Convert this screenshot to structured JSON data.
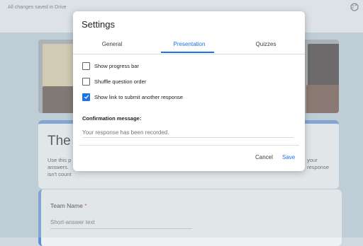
{
  "app": {
    "save_status": "All changes saved in Drive"
  },
  "form": {
    "title": "The",
    "description_left": "Use this p\nanswers. \nisn't count",
    "description_right": "your\nresponse",
    "question": {
      "label": "Team Name",
      "required_mark": "*",
      "placeholder": "Short-answer text"
    }
  },
  "dialog": {
    "title": "Settings",
    "tabs": [
      {
        "label": "General",
        "active": false
      },
      {
        "label": "Presentation",
        "active": true
      },
      {
        "label": "Quizzes",
        "active": false
      }
    ],
    "options": [
      {
        "label": "Show progress bar",
        "checked": false
      },
      {
        "label": "Shuffle question order",
        "checked": false
      },
      {
        "label": "Show link to submit another response",
        "checked": true
      }
    ],
    "confirmation_label": "Confirmation message:",
    "confirmation_placeholder": "Your response has been recorded.",
    "cancel_label": "Cancel",
    "save_label": "Save"
  },
  "colors": {
    "accent": "#1a73e8",
    "form_theme": "#5b8fd6"
  }
}
